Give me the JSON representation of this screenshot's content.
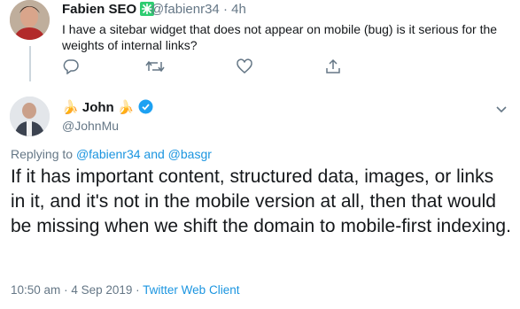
{
  "parent_tweet": {
    "author_name": "Fabien SEO",
    "handle": "@fabienr34",
    "separator": "·",
    "time": "4h",
    "text": "I have a sitebar widget that does not appear on mobile (bug) is it serious for the weights of internal links?",
    "actions": [
      "reply-icon",
      "retweet-icon",
      "like-icon",
      "share-icon"
    ]
  },
  "reply_tweet": {
    "author_name": "John",
    "handle": "@JohnMu",
    "replying_prefix": "Replying to",
    "reply_handle_1": "@fabienr34",
    "reply_and": "and",
    "reply_handle_2": "@basgr",
    "text": "If it has important content, structured data, images, or links in it, and it's not in the mobile version at all, then that would be missing when we shift the domain to mobile-first indexing.",
    "time": "10:50 am",
    "date": "4 Sep 2019",
    "meta_sep": "·",
    "client": "Twitter Web Client"
  },
  "colors": {
    "text": "#14171a",
    "secondary": "#657786",
    "link": "#1b95e0",
    "verified": "#1da1f2",
    "badge_green": "#2ecc71"
  }
}
